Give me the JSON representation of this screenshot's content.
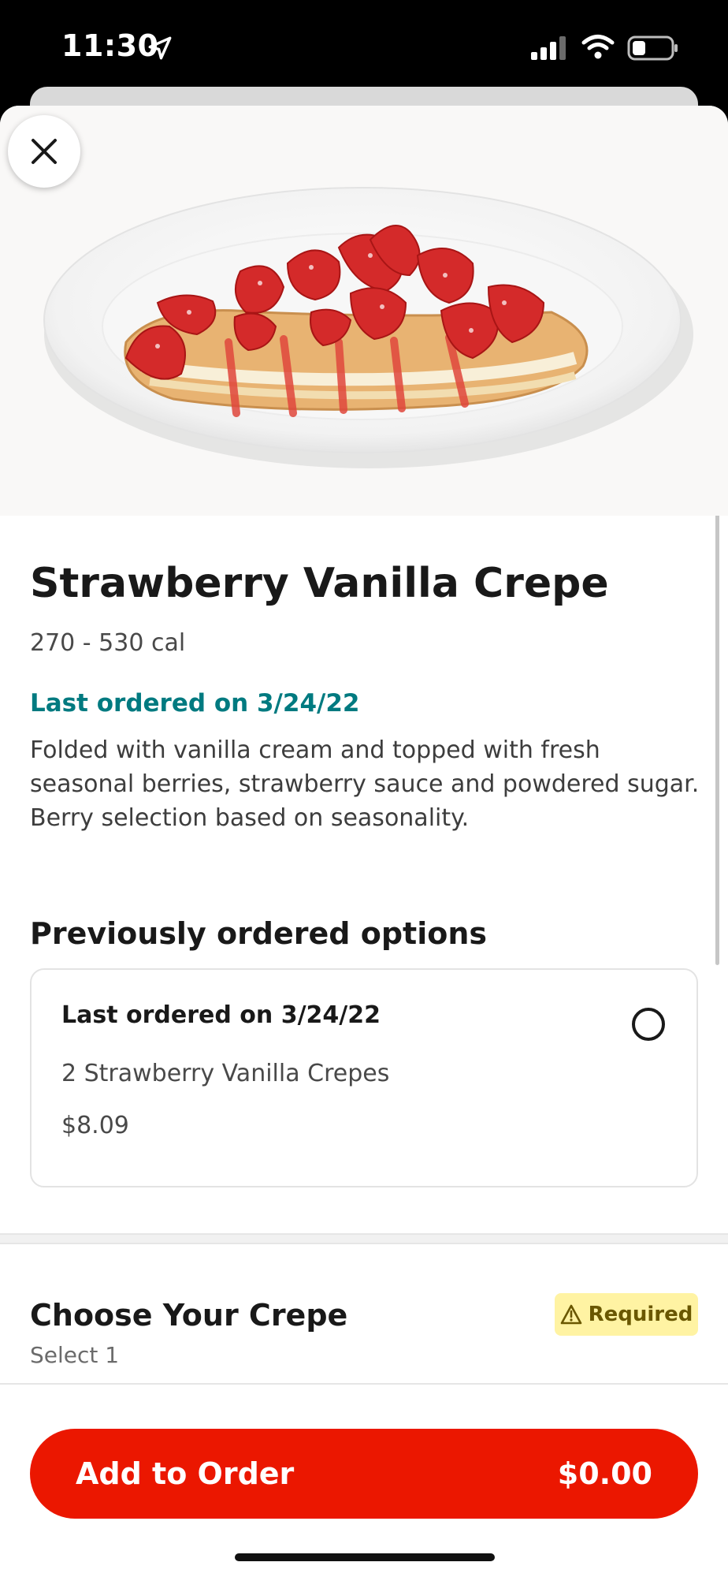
{
  "status_bar": {
    "time": "11:30"
  },
  "item": {
    "title": "Strawberry Vanilla Crepe",
    "calories": "270 - 530 cal",
    "last_ordered": "Last ordered on 3/24/22",
    "description": "Folded with vanilla cream and topped with fresh seasonal berries, strawberry sauce and powdered sugar. Berry selection based on seasonality."
  },
  "previous_options": {
    "heading": "Previously ordered options",
    "card": {
      "title": "Last ordered on 3/24/22",
      "item": "2 Strawberry Vanilla Crepes",
      "price": "$8.09",
      "selected": false
    }
  },
  "choose_crepe": {
    "title": "Choose Your Crepe",
    "subtitle": "Select 1",
    "badge": "Required"
  },
  "footer": {
    "add_label": "Add to Order",
    "price": "$0.00"
  },
  "colors": {
    "accent_red": "#eb1700",
    "teal": "#007a80",
    "required_bg": "#fff3a3"
  }
}
